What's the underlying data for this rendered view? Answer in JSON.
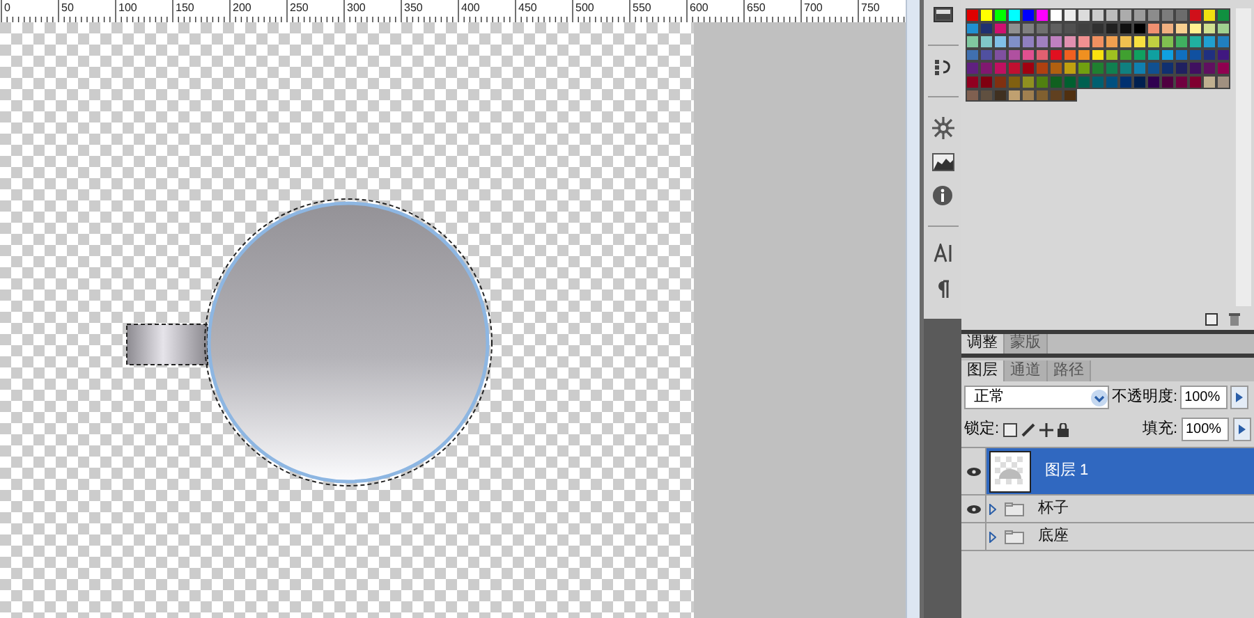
{
  "ruler": {
    "labels": [
      "0",
      "50",
      "100",
      "150",
      "200",
      "250",
      "300",
      "350",
      "400",
      "450",
      "500",
      "550",
      "600",
      "650",
      "700",
      "750"
    ]
  },
  "swatches": {
    "rows": [
      [
        {
          "color": "#e00000"
        },
        {
          "color": "#ffff00"
        },
        {
          "color": "#00ff00"
        },
        {
          "color": "#00ffff"
        },
        {
          "color": "#0000ff"
        },
        {
          "color": "#ff00ff"
        },
        {
          "color": "#ffffff"
        },
        {
          "color": "#ececec"
        },
        {
          "color": "#dcdcdc"
        },
        {
          "color": "#cccccc"
        },
        {
          "color": "#bcbcbc"
        },
        {
          "color": "#acacac"
        },
        {
          "color": "#9c9c9c"
        },
        {
          "color": "#8c8c8c"
        },
        {
          "color": "#7c7c7c"
        },
        {
          "color": "#6c6c6c"
        },
        {
          "color": "#d0101a"
        },
        {
          "color": "#f0e010"
        },
        {
          "color": "#109040"
        }
      ],
      [
        {
          "color": "#2090d0"
        },
        {
          "color": "#203070"
        },
        {
          "color": "#d01070"
        },
        {
          "color": "#909090"
        },
        {
          "color": "#808080"
        },
        {
          "color": "#707070"
        },
        {
          "color": "#606060"
        },
        {
          "color": "#505050"
        },
        {
          "color": "#404040"
        },
        {
          "color": "#303030"
        },
        {
          "color": "#202020"
        },
        {
          "color": "#101010"
        },
        {
          "color": "#000000"
        },
        {
          "color": "#f09070"
        },
        {
          "color": "#f0b080"
        },
        {
          "color": "#f8d090"
        },
        {
          "color": "#fff090"
        },
        {
          "color": "#d0e090"
        },
        {
          "color": "#a0d090"
        }
      ],
      [
        {
          "color": "#80c8a0"
        },
        {
          "color": "#80c8c8"
        },
        {
          "color": "#80c0e8"
        },
        {
          "color": "#8090c8"
        },
        {
          "color": "#9080c0"
        },
        {
          "color": "#a080c0"
        },
        {
          "color": "#c080c0"
        },
        {
          "color": "#e090b0"
        },
        {
          "color": "#f09090"
        },
        {
          "color": "#f09060"
        },
        {
          "color": "#f0a050"
        },
        {
          "color": "#f0c050"
        },
        {
          "color": "#f8e040"
        },
        {
          "color": "#c0d040"
        },
        {
          "color": "#80c050"
        },
        {
          "color": "#40b060"
        },
        {
          "color": "#20b0a0"
        },
        {
          "color": "#20a0d0"
        },
        {
          "color": "#2080c0"
        }
      ],
      [
        {
          "color": "#4070b0"
        },
        {
          "color": "#5050a0"
        },
        {
          "color": "#8050a0"
        },
        {
          "color": "#b050a0"
        },
        {
          "color": "#e05090"
        },
        {
          "color": "#e06070"
        },
        {
          "color": "#e01020"
        },
        {
          "color": "#f06020"
        },
        {
          "color": "#f09020"
        },
        {
          "color": "#f8e010"
        },
        {
          "color": "#a0c020"
        },
        {
          "color": "#40a030"
        },
        {
          "color": "#10a060"
        },
        {
          "color": "#10a0a0"
        },
        {
          "color": "#10a0e0"
        },
        {
          "color": "#1070c0"
        },
        {
          "color": "#1050a0"
        },
        {
          "color": "#203080"
        },
        {
          "color": "#401880"
        }
      ],
      [
        {
          "color": "#602080"
        },
        {
          "color": "#801870"
        },
        {
          "color": "#c01060"
        },
        {
          "color": "#c01030"
        },
        {
          "color": "#a00010"
        },
        {
          "color": "#b04010"
        },
        {
          "color": "#b06010"
        },
        {
          "color": "#c0a010"
        },
        {
          "color": "#70a010"
        },
        {
          "color": "#208030"
        },
        {
          "color": "#108050"
        },
        {
          "color": "#108080"
        },
        {
          "color": "#1080b0"
        },
        {
          "color": "#105090"
        },
        {
          "color": "#103070"
        },
        {
          "color": "#202060"
        },
        {
          "color": "#401060"
        },
        {
          "color": "#601060"
        },
        {
          "color": "#900050"
        }
      ],
      [
        {
          "color": "#900020"
        },
        {
          "color": "#800010"
        },
        {
          "color": "#803010"
        },
        {
          "color": "#806010"
        },
        {
          "color": "#909020"
        },
        {
          "color": "#508010"
        },
        {
          "color": "#106020"
        },
        {
          "color": "#006030"
        },
        {
          "color": "#006050"
        },
        {
          "color": "#006070"
        },
        {
          "color": "#005080"
        },
        {
          "color": "#003070"
        },
        {
          "color": "#002050"
        },
        {
          "color": "#300050"
        },
        {
          "color": "#500040"
        },
        {
          "color": "#700040"
        },
        {
          "color": "#800030"
        },
        {
          "color": "#c0b090"
        },
        {
          "color": "#a09080"
        }
      ],
      [
        {
          "color": "#806050"
        },
        {
          "color": "#605040"
        },
        {
          "color": "#403020"
        },
        {
          "color": "#c0a070"
        },
        {
          "color": "#a08050"
        },
        {
          "color": "#806030"
        },
        {
          "color": "#604020"
        },
        {
          "color": "#503010"
        }
      ]
    ]
  },
  "adjust_tabs": [
    {
      "label": "调整",
      "selected": true
    },
    {
      "label": "蒙版",
      "selected": false
    }
  ],
  "layer_tabs": [
    {
      "label": "图层",
      "selected": true
    },
    {
      "label": "通道",
      "selected": false
    },
    {
      "label": "路径",
      "selected": false
    }
  ],
  "blend_mode": {
    "value": "正常"
  },
  "opacity": {
    "label": "不透明度:",
    "value": "100%"
  },
  "lock": {
    "label": "锁定:"
  },
  "fill": {
    "label": "填充:",
    "value": "100%"
  },
  "layers": [
    {
      "kind": "layer",
      "name": "图层 1",
      "visible": true,
      "selected": true
    },
    {
      "kind": "group",
      "name": "杯子",
      "visible": true,
      "selected": false
    },
    {
      "kind": "group",
      "name": "底座",
      "visible": false,
      "selected": false
    }
  ]
}
